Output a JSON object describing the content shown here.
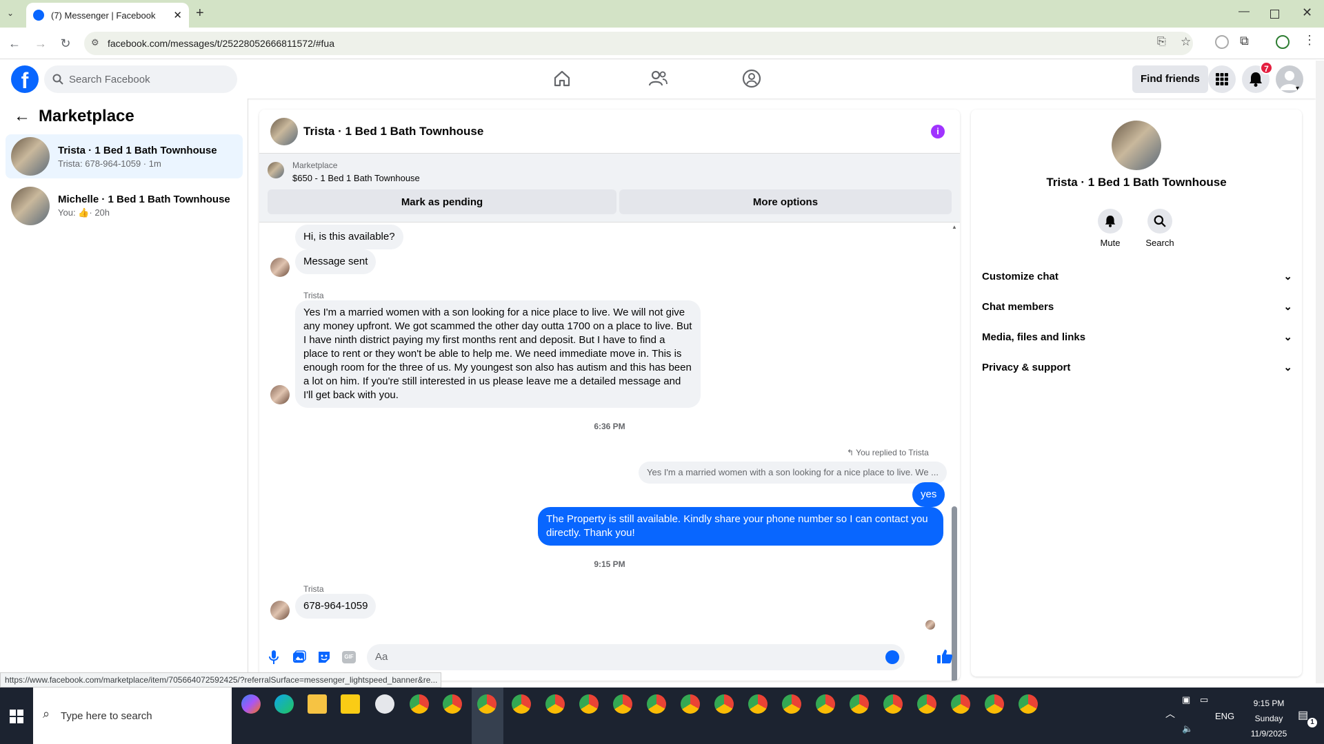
{
  "browser": {
    "tab_title": "(7) Messenger | Facebook",
    "url": "facebook.com/messages/t/25228052666811572/#fua",
    "status_url": "https://www.facebook.com/marketplace/item/705664072592425/?referralSurface=messenger_lightspeed_banner&re..."
  },
  "fb": {
    "search_placeholder": "Search Facebook",
    "find_friends": "Find friends",
    "notification_count": "7"
  },
  "left": {
    "title": "Marketplace",
    "conversations": [
      {
        "name": "Trista · 1 Bed 1 Bath Townhouse",
        "snippet": "Trista: 678-964-1059 · 1m"
      },
      {
        "name": "Michelle · 1 Bed 1 Bath Townhouse",
        "snippet_prefix": "You:",
        "snippet_suffix": "· 20h"
      }
    ]
  },
  "chat": {
    "title": "Trista · 1 Bed 1 Bath Townhouse",
    "listing_label": "Marketplace",
    "listing_title": "$650 - 1 Bed 1 Bath Townhouse",
    "mark_pending": "Mark as pending",
    "more_options": "More options",
    "messages": {
      "m1": "Hi, is this available?",
      "m2": "Message sent",
      "sender": "Trista",
      "m3": "Yes I'm a married women with a son looking for a nice place to live. We will not give any money upfront. We got scammed the other day outta 1700 on a place to live. But I have ninth district paying my first months rent and deposit. But I have to find a place to rent or they won't be able to help me. We need immediate move in. This is enough room for the three of us. My youngest son also has autism and this has been a lot on him. If you're still interested in us please leave me a detailed message and I'll get back with you.",
      "time1": "6:36 PM",
      "replied_label": "You replied to Trista",
      "quoted": "Yes I'm a married women with a son looking for a nice place to live. We ...",
      "reply_yes": "yes",
      "reply_long": "The Property is still available. Kindly share your phone number so I can contact you directly. Thank you!",
      "time2": "9:15 PM",
      "sender2": "Trista",
      "m4": "678-964-1059"
    },
    "composer_placeholder": "Aa"
  },
  "right": {
    "name": "Trista · 1 Bed 1 Bath Townhouse",
    "mute": "Mute",
    "search": "Search",
    "sections": [
      "Customize chat",
      "Chat members",
      "Media, files and links",
      "Privacy & support"
    ]
  },
  "taskbar": {
    "search_placeholder": "Type here to search",
    "lang": "ENG",
    "time": "9:15 PM",
    "day": "Sunday",
    "date": "11/9/2025",
    "notif": "1"
  },
  "colors": {
    "fb_blue": "#0866ff",
    "accent_purple": "#a033ff",
    "taskbar": "#1c2330"
  }
}
